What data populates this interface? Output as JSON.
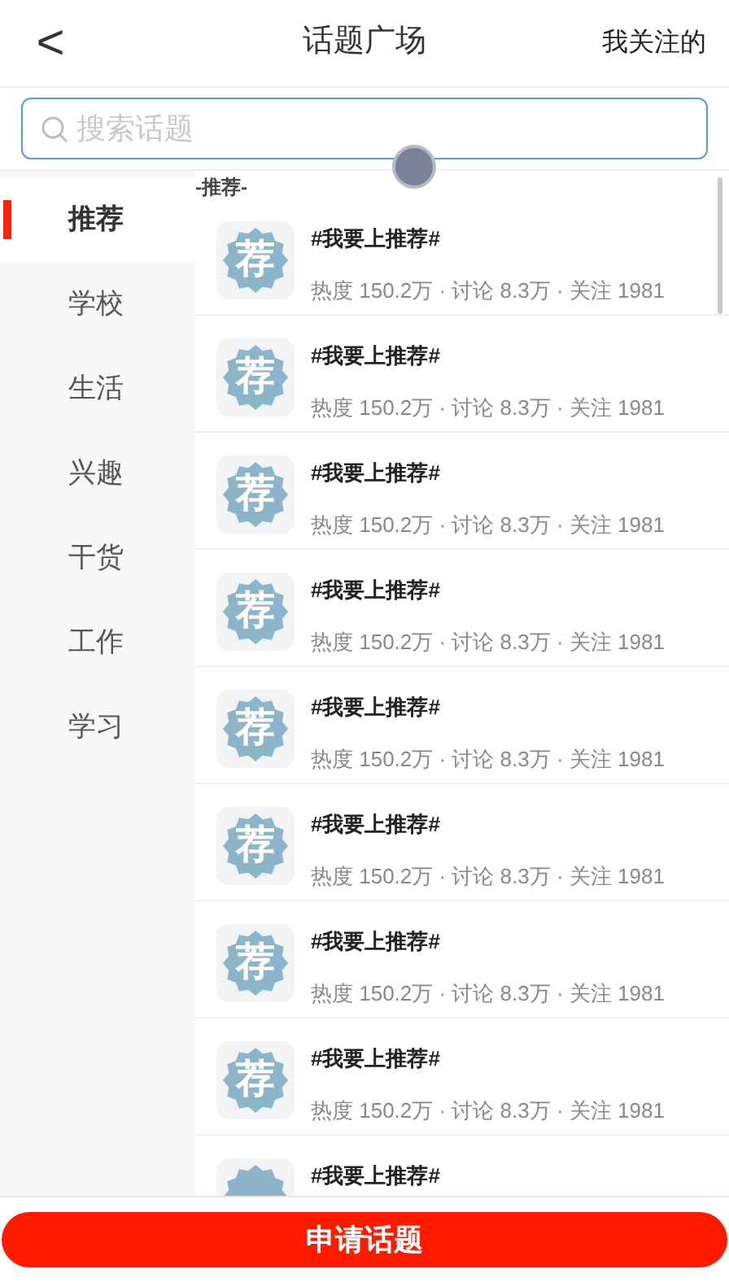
{
  "header": {
    "back": "<",
    "title": "话题广场",
    "action": "我关注的"
  },
  "search": {
    "placeholder": "搜索话题"
  },
  "sidebar": {
    "items": [
      {
        "label": "推荐",
        "selected": true
      },
      {
        "label": "学校",
        "selected": false
      },
      {
        "label": "生活",
        "selected": false
      },
      {
        "label": "兴趣",
        "selected": false
      },
      {
        "label": "干货",
        "selected": false
      },
      {
        "label": "工作",
        "selected": false
      },
      {
        "label": "学习",
        "selected": false
      }
    ]
  },
  "section_title": "-推荐-",
  "topics": [
    {
      "badge": "荐",
      "title": "#我要上推荐#",
      "stats": "热度 150.2万 · 讨论 8.3万 · 关注 1981"
    },
    {
      "badge": "荐",
      "title": "#我要上推荐#",
      "stats": "热度 150.2万 · 讨论 8.3万 · 关注 1981"
    },
    {
      "badge": "荐",
      "title": "#我要上推荐#",
      "stats": "热度 150.2万 · 讨论 8.3万 · 关注 1981"
    },
    {
      "badge": "荐",
      "title": "#我要上推荐#",
      "stats": "热度 150.2万 · 讨论 8.3万 · 关注 1981"
    },
    {
      "badge": "荐",
      "title": "#我要上推荐#",
      "stats": "热度 150.2万 · 讨论 8.3万 · 关注 1981"
    },
    {
      "badge": "荐",
      "title": "#我要上推荐#",
      "stats": "热度 150.2万 · 讨论 8.3万 · 关注 1981"
    },
    {
      "badge": "荐",
      "title": "#我要上推荐#",
      "stats": "热度 150.2万 · 讨论 8.3万 · 关注 1981"
    },
    {
      "badge": "荐",
      "title": "#我要上推荐#",
      "stats": "热度 150.2万 · 讨论 8.3万 · 关注 1981"
    },
    {
      "title": "#我要上推荐#"
    }
  ],
  "apply_button": "申请话题"
}
